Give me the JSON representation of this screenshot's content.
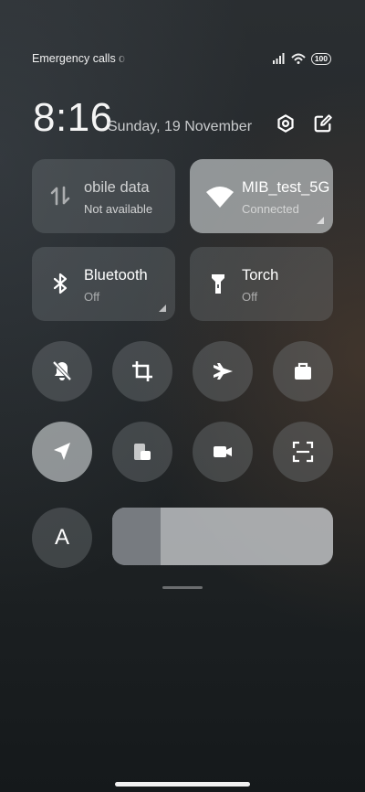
{
  "status_bar": {
    "carrier_text": "Emergency calls o",
    "battery": "100",
    "icons": [
      "signal-icon",
      "hotspot-icon",
      "battery-icon"
    ]
  },
  "header": {
    "time": "8:16",
    "date": "Sunday, 19 November",
    "icons": [
      "settings-icon",
      "edit-icon"
    ]
  },
  "tiles": [
    {
      "title": "obile data",
      "subtitle": "Not available",
      "icon": "mobile-data-icon",
      "active": false
    },
    {
      "title": "MIB_test_5G",
      "subtitle": "Connected",
      "icon": "wifi-icon",
      "active": true
    },
    {
      "title": "Bluetooth",
      "subtitle": "Off",
      "icon": "bluetooth-icon",
      "active": false
    },
    {
      "title": "Torch",
      "subtitle": "Off",
      "icon": "torch-icon",
      "active": false
    }
  ],
  "toggles": [
    {
      "icon": "silent-icon",
      "active": false
    },
    {
      "icon": "screenshot-crop-icon",
      "active": false
    },
    {
      "icon": "airplane-icon",
      "active": false
    },
    {
      "icon": "briefcase-icon",
      "active": false
    },
    {
      "icon": "location-icon",
      "active": true
    },
    {
      "icon": "floating-window-icon",
      "active": false
    },
    {
      "icon": "video-camera-icon",
      "active": false
    },
    {
      "icon": "scanner-icon",
      "active": false
    }
  ],
  "brightness": {
    "auto_label": "A",
    "level": 0.22
  },
  "colors": {
    "tile_active": "#d2d6d8",
    "tile_inactive": "#787e82"
  }
}
